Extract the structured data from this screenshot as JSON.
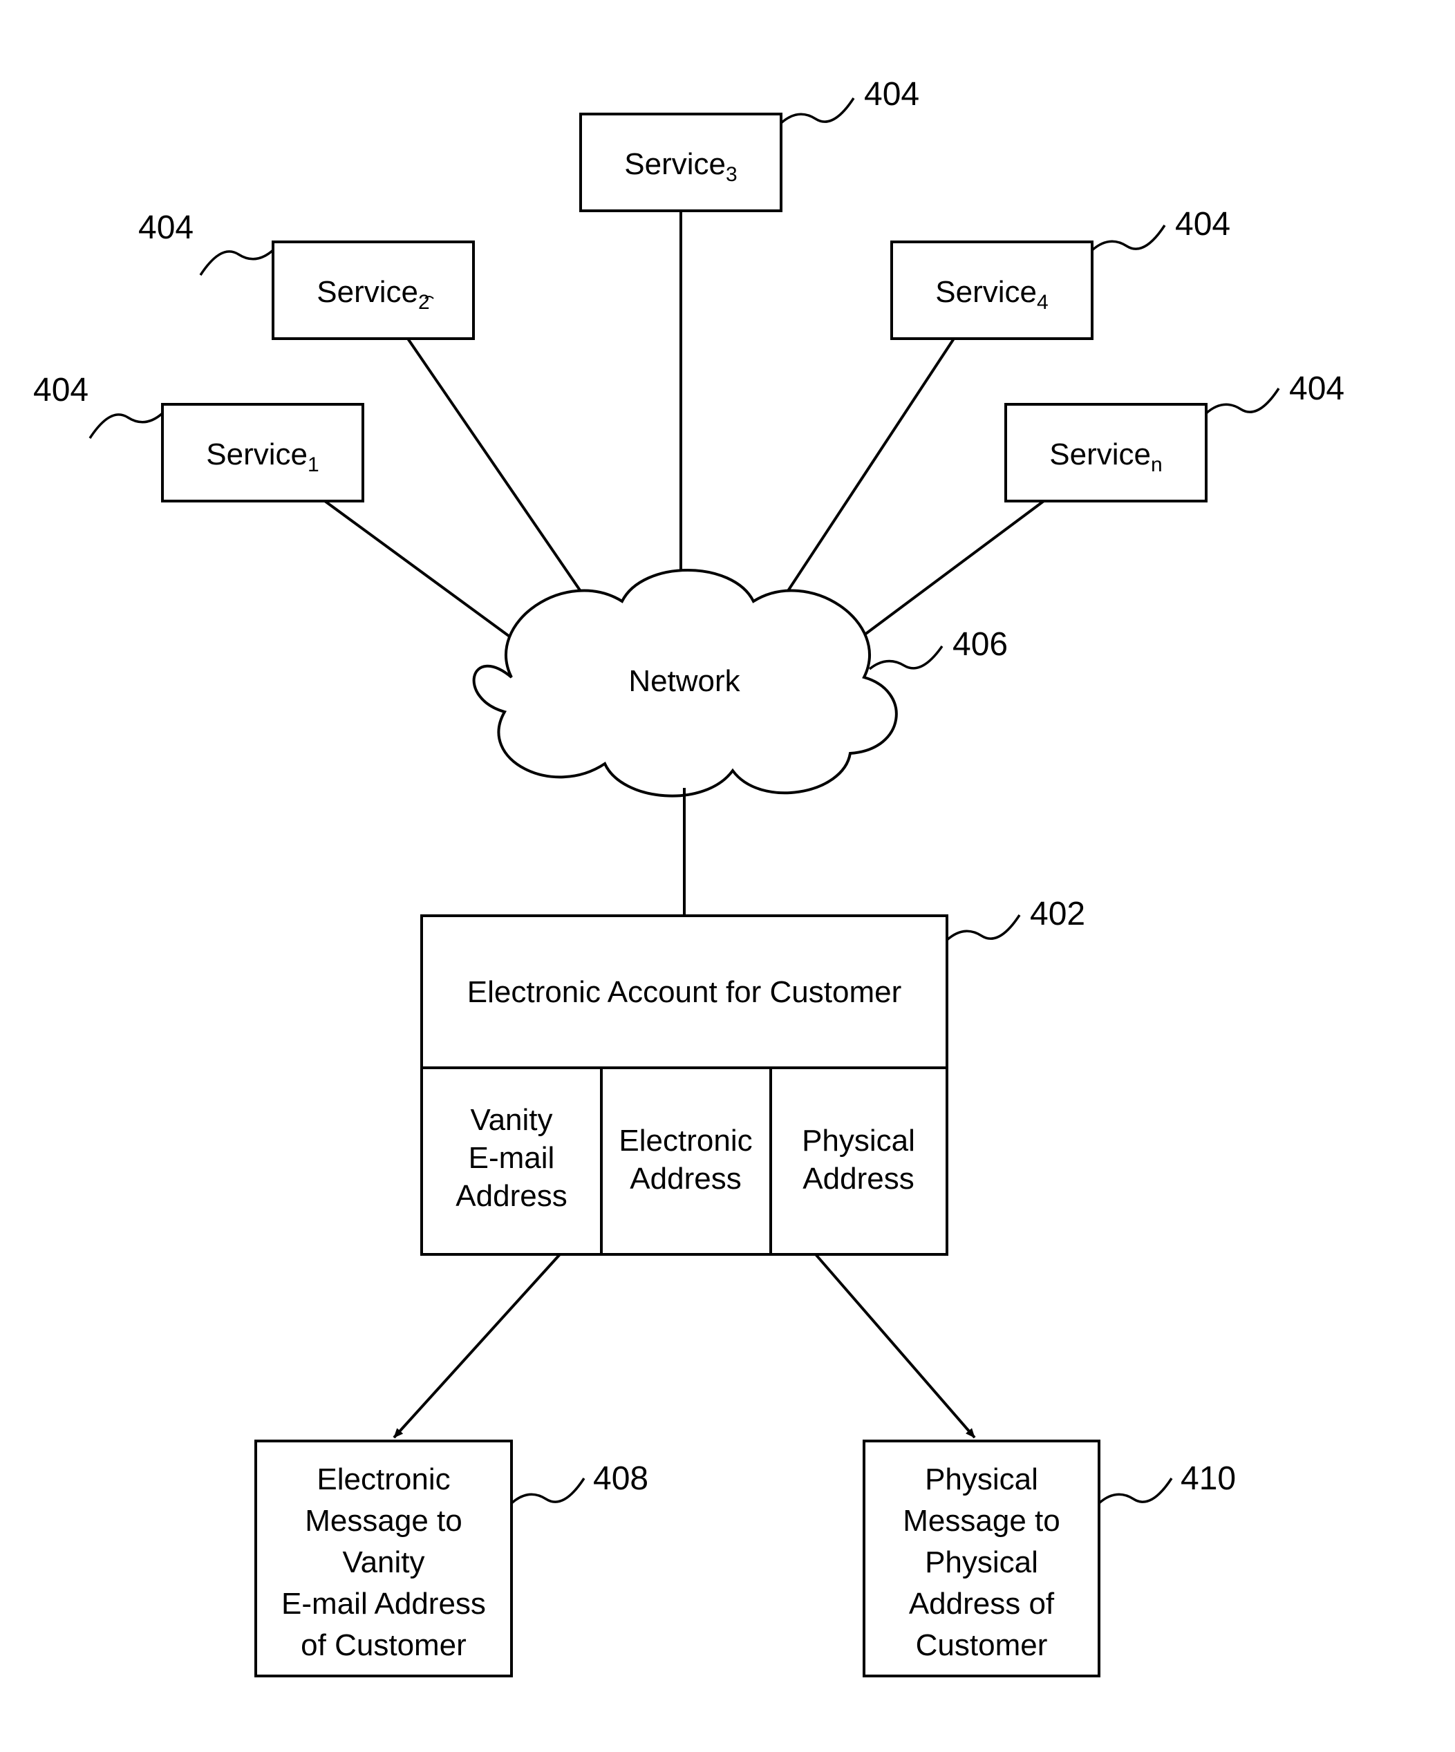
{
  "services": {
    "s1": {
      "label": "Service",
      "sub": "1",
      "ref": "404"
    },
    "s2": {
      "label": "Service",
      "sub": "2",
      "ref": "404"
    },
    "s3": {
      "label": "Service",
      "sub": "3",
      "ref": "404"
    },
    "s4": {
      "label": "Service",
      "sub": "4",
      "ref": "404"
    },
    "sn": {
      "label": "Service",
      "sub": "n",
      "ref": "404"
    }
  },
  "network": {
    "label": "Network",
    "ref": "406"
  },
  "account": {
    "title": "Electronic Account for Customer",
    "ref": "402",
    "col1_line1": "Vanity",
    "col1_line2": "E-mail",
    "col1_line3": "Address",
    "col2_line1": "Electronic",
    "col2_line2": "Address",
    "col3_line1": "Physical",
    "col3_line2": "Address"
  },
  "msg_email": {
    "line1": "Electronic",
    "line2": "Message to",
    "line3": "Vanity",
    "line4": "E-mail Address",
    "line5": "of Customer",
    "ref": "408"
  },
  "msg_physical": {
    "line1": "Physical",
    "line2": "Message to",
    "line3": "Physical",
    "line4": "Address of",
    "line5": "Customer",
    "ref": "410"
  }
}
